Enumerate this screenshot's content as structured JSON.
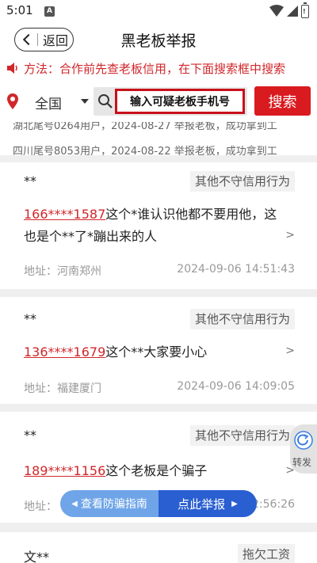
{
  "status_bar": {
    "time": "5:01",
    "notif_badge": "A"
  },
  "nav": {
    "back_label": "返回",
    "title": "黑老板举报"
  },
  "notice": {
    "text": "方法：合作前先查老板信用，在下面搜索框中搜索"
  },
  "search": {
    "region": "全国",
    "placeholder": "输入可疑老板手机号",
    "button_label": "搜索"
  },
  "ticker": [
    "湖北尾号0264用户，2024-08-27 举报老板，成功拿到工",
    "四川尾号8053用户，2024-08-22 举报老板，成功拿到工"
  ],
  "reports": [
    {
      "author": "**",
      "tag": "其他不守信用行为",
      "phone": "166****1587",
      "text": "这个*谁认识他都不要用他，这也是个**了*蹦出来的人",
      "address": "地址：河南郑州",
      "time": "2024-09-06 14:51:43"
    },
    {
      "author": "**",
      "tag": "其他不守信用行为",
      "phone": "136****1679",
      "text": "这个**大家要小心",
      "address": "地址：福建厦门",
      "time": "2024-09-06 14:09:05"
    },
    {
      "author": "**",
      "tag": "其他不守信用行为",
      "phone": "189****1156",
      "text": "这个老板是个骗子",
      "address": "地址：",
      "time": "2:56:26"
    },
    {
      "author": "文**",
      "tag": "拖欠工资"
    }
  ],
  "share": {
    "label": "转发"
  },
  "bottom_actions": {
    "guide_label": "查看防骗指南",
    "report_label": "点此举报"
  },
  "colors": {
    "accent_red": "#d91a1f",
    "primary_blue": "#2a5fd1",
    "light_blue": "#6fa5e8"
  }
}
